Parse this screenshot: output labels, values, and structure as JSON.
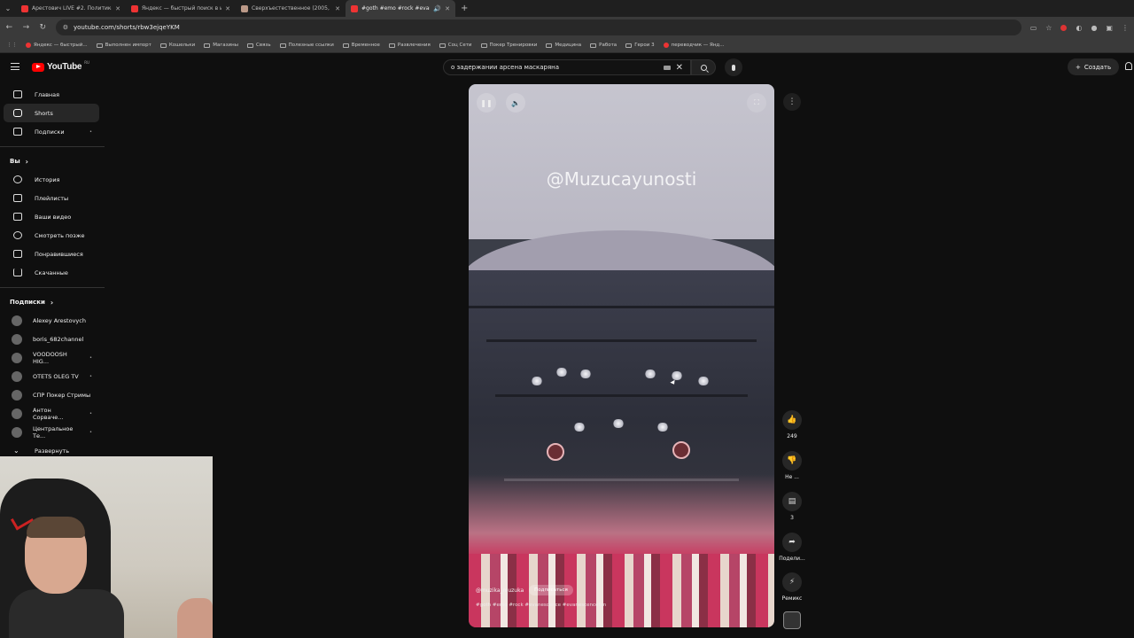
{
  "browser": {
    "tabs": [
      {
        "title": "Арестович LIVE #2. Политика",
        "color": "#e33"
      },
      {
        "title": "Яндекс — быстрый поиск в ин",
        "color": "#e33"
      },
      {
        "title": "Сверхъестественное (2005, се",
        "color": "#b98"
      },
      {
        "title": "#goth #emo #rock #evanesc",
        "color": "#e33"
      }
    ],
    "url": "youtube.com/shorts/rbw3ejqeYKM",
    "bookmarks": [
      "Яндекс — быстрый...",
      "Выполнен импорт",
      "Кошельки",
      "Магазины",
      "Связь",
      "Полезные ссылки",
      "Временное",
      "Развлечения",
      "Соц Сети",
      "Покер Тренировки",
      "Медицина",
      "Работа",
      "Герои 3",
      "переводчик — Янд..."
    ]
  },
  "header": {
    "logo_text": "YouTube",
    "logo_region": "RU",
    "search_value": "о задержании арсена маскаряна",
    "create_label": "Создать"
  },
  "sidebar": {
    "main": [
      {
        "label": "Главная",
        "icon": "home-icon"
      },
      {
        "label": "Shorts",
        "icon": "shorts-icon"
      },
      {
        "label": "Подписки",
        "icon": "subscriptions-icon",
        "dot": "•"
      }
    ],
    "you_heading": "Вы",
    "you": [
      {
        "label": "История",
        "icon": "history-icon"
      },
      {
        "label": "Плейлисты",
        "icon": "playlists-icon"
      },
      {
        "label": "Ваши видео",
        "icon": "your-videos-icon"
      },
      {
        "label": "Смотреть позже",
        "icon": "watch-later-icon"
      },
      {
        "label": "Понравившиеся",
        "icon": "liked-icon"
      },
      {
        "label": "Скачанные",
        "icon": "downloads-icon"
      }
    ],
    "subs_heading": "Подписки",
    "subs": [
      {
        "label": "Alexey Arestovych",
        "dot": ""
      },
      {
        "label": "boris_682channel",
        "dot": ""
      },
      {
        "label": "VOODOOSH HIG...",
        "dot": "•"
      },
      {
        "label": "OTETS OLEG TV",
        "dot": "•"
      },
      {
        "label": "СПР Покер Стримы",
        "dot": ""
      },
      {
        "label": "Антон Сорвачe...",
        "dot": "•"
      },
      {
        "label": "Центральное Те...",
        "dot": "•"
      }
    ],
    "expand_label": "Развернуть"
  },
  "player": {
    "watermark": "@Muzucayunosti",
    "channel": "@muzika_muzuka",
    "subscribe_label": "Подписаться",
    "tags": "#goth #emo #rock #evanescence #evanescencefan"
  },
  "actions": {
    "likes": "249",
    "dislike_label": "Не ...",
    "comments": "3",
    "share_label": "Подели...",
    "remix_label": "Ремикс"
  }
}
